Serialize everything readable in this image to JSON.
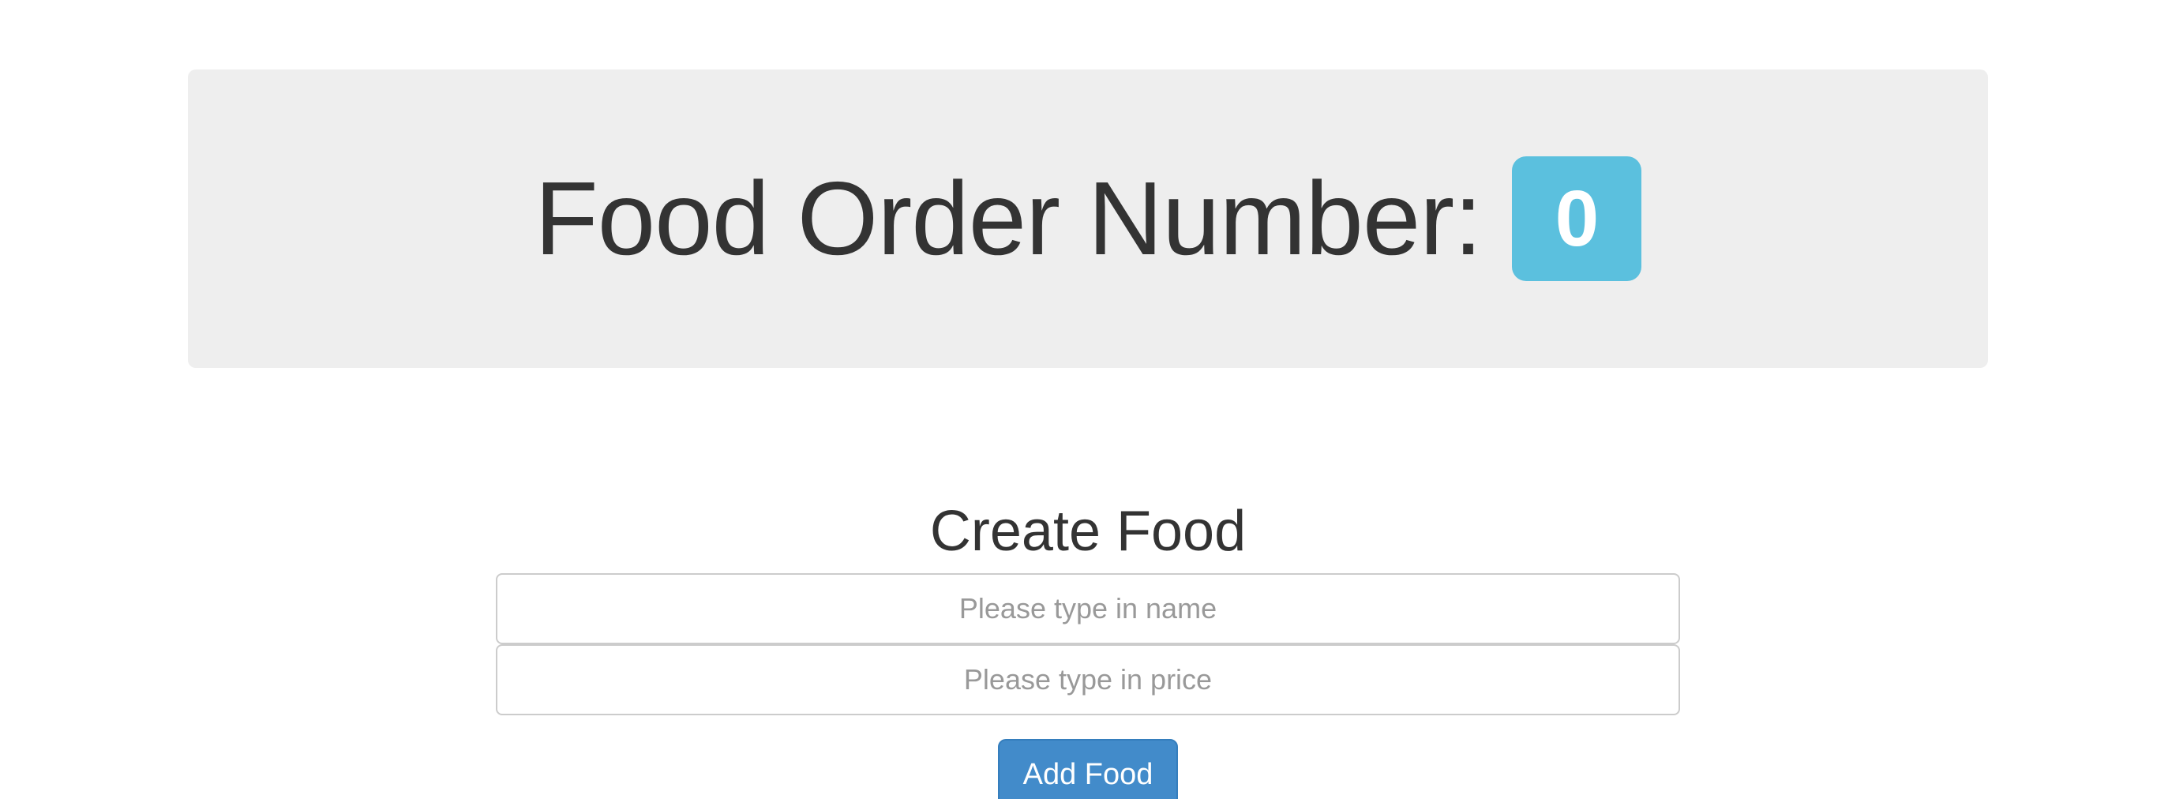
{
  "header": {
    "title": "Food Order Number:",
    "order_count": "0"
  },
  "create_food": {
    "title": "Create Food",
    "name_placeholder": "Please type in name",
    "price_placeholder": "Please type in price",
    "name_value": "",
    "price_value": "",
    "add_button_label": "Add Food"
  },
  "colors": {
    "jumbotron_bg": "#eeeeee",
    "badge_bg": "#5bc0de",
    "primary_button": "#428bca",
    "text": "#333333"
  }
}
